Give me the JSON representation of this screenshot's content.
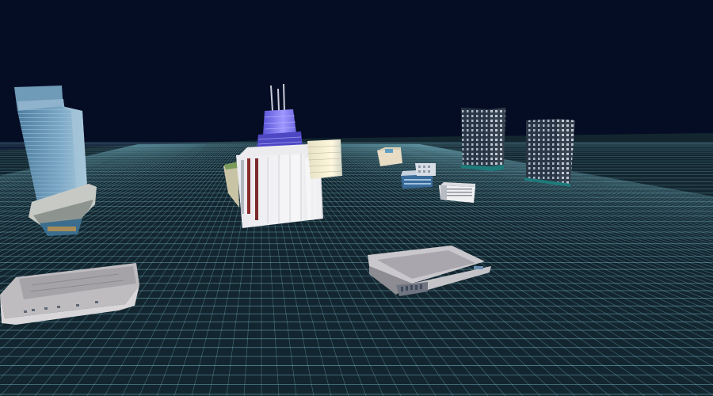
{
  "scene": {
    "sky_color": "#050d24",
    "ground_color": "#13262f",
    "grid_color": "#8fd6e8",
    "buildings": [
      {
        "name": "glass-skyscraper-left",
        "kind": "glass tower"
      },
      {
        "name": "blue-crown-tower",
        "kind": "antenna tower with blue lit crown"
      },
      {
        "name": "white-stone-building",
        "kind": "white stone building"
      },
      {
        "name": "lit-glass-block",
        "kind": "glass block"
      },
      {
        "name": "small-beige-building",
        "kind": "low-rise"
      },
      {
        "name": "blue-low-rise",
        "kind": "low-rise"
      },
      {
        "name": "small-white-office",
        "kind": "office"
      },
      {
        "name": "white-striped-office",
        "kind": "office"
      },
      {
        "name": "dark-office-tower-1",
        "kind": "dark office tower"
      },
      {
        "name": "dark-office-tower-2",
        "kind": "dark office tower"
      },
      {
        "name": "flat-mall-center",
        "kind": "flat low building"
      },
      {
        "name": "flat-warehouse-left",
        "kind": "flat low building"
      }
    ]
  }
}
